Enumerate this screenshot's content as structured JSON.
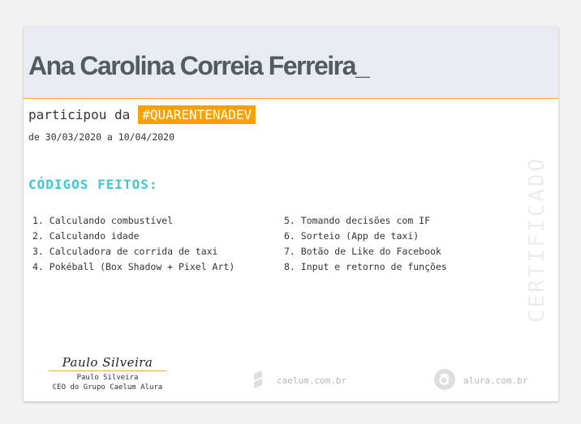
{
  "certificate": {
    "name": "Ana Carolina Correia Ferreira_",
    "participated_text": "participou da",
    "event_tag": "#QUARENTENADEV",
    "date_range": "de 30/03/2020 a 10/04/2020",
    "section_title": "CÓDIGOS FEITOS:",
    "watermark": "CERTIFICADO",
    "codes_left": [
      "1. Calculando combustível",
      "2. Calculando idade",
      "3. Calculadora de corrida de taxi",
      "4. Pokéball (Box Shadow + Pixel Art)"
    ],
    "codes_right": [
      "5. Tomando decisões com IF",
      "6. Sorteio (App de taxi)",
      "7. Botão de Like do Facebook",
      "8. Input e retorno de funções"
    ]
  },
  "footer": {
    "signature": "Paulo Silveira",
    "signer_name": "Paulo Silveira",
    "signer_role": "CEO do Grupo Caelum Alura",
    "caelum_url": "caelum.com.br",
    "alura_url": "alura.com.br"
  },
  "colors": {
    "accent": "#f5a100",
    "title": "#3ec8d0",
    "header_bg": "#e8ebf1"
  }
}
